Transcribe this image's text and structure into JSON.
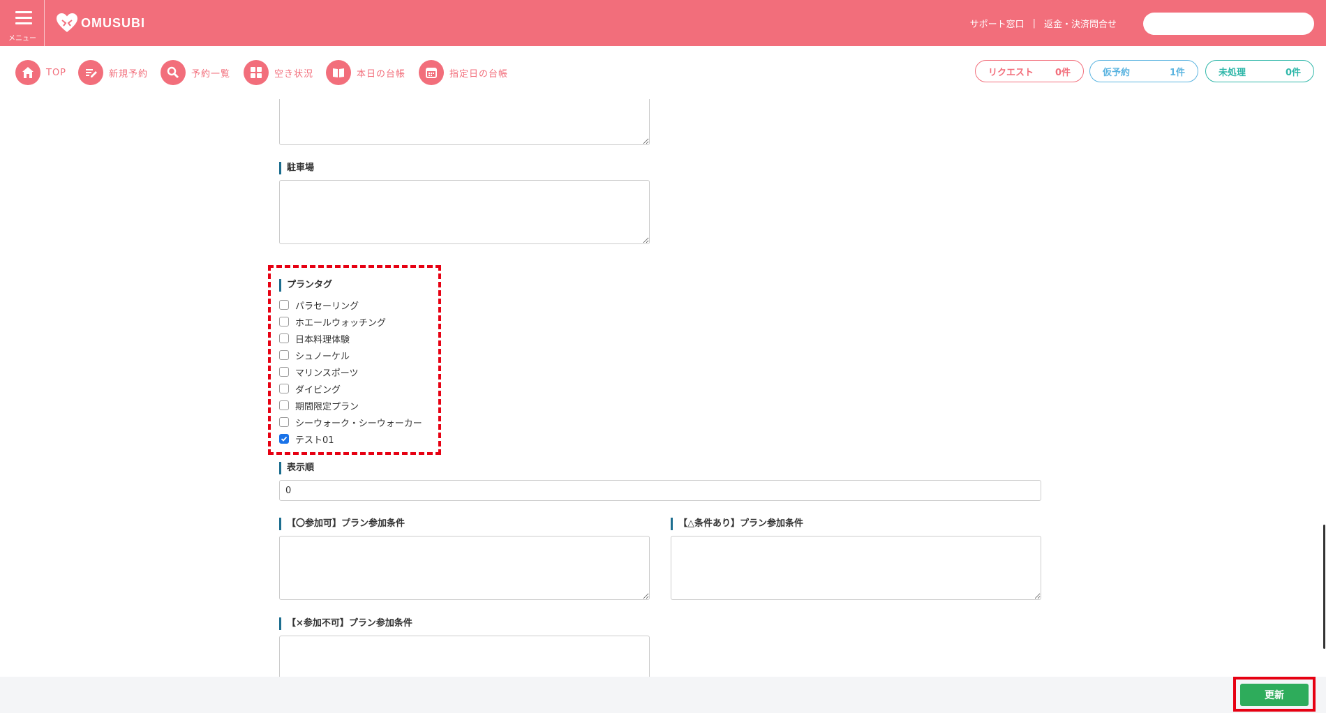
{
  "header": {
    "menu_label": "メニュー",
    "logo_text": "OMUSUBI",
    "links": {
      "support": "サポート窓口",
      "refund": "返金・決済問合せ"
    },
    "search_placeholder": ""
  },
  "nav": {
    "items": [
      {
        "label": "TOP",
        "icon": "home-icon"
      },
      {
        "label": "新規予約",
        "icon": "pencil-icon"
      },
      {
        "label": "予約一覧",
        "icon": "search-icon"
      },
      {
        "label": "空き状況",
        "icon": "grid-icon"
      },
      {
        "label": "本日の台帳",
        "icon": "book-icon"
      },
      {
        "label": "指定日の台帳",
        "icon": "calendar-icon"
      }
    ],
    "pills": {
      "request": {
        "label": "リクエスト",
        "count": "0件"
      },
      "provisional": {
        "label": "仮予約",
        "count": "1件"
      },
      "unprocessed": {
        "label": "未処理",
        "count": "0件"
      }
    }
  },
  "form": {
    "parking_label": "駐車場",
    "plan_tag_label": "プランタグ",
    "plan_tags": [
      {
        "label": "パラセーリング",
        "checked": false
      },
      {
        "label": "ホエールウォッチング",
        "checked": false
      },
      {
        "label": "日本料理体験",
        "checked": false
      },
      {
        "label": "シュノーケル",
        "checked": false
      },
      {
        "label": "マリンスポーツ",
        "checked": false
      },
      {
        "label": "ダイビング",
        "checked": false
      },
      {
        "label": "期間限定プラン",
        "checked": false
      },
      {
        "label": "シーウォーク・シーウォーカー",
        "checked": false
      },
      {
        "label": "テスト01",
        "checked": true
      }
    ],
    "display_order_label": "表示順",
    "display_order_value": "0",
    "cond_ok_label": "【〇参加可】プラン参加条件",
    "cond_conditional_label": "【△条件あり】プラン参加条件",
    "cond_ng_label": "【×参加不可】プラン参加条件"
  },
  "footer": {
    "update_label": "更新"
  },
  "colors": {
    "brand": "#f26e7b",
    "label_bar": "#1d6e8f",
    "update": "#2eac5b",
    "highlight": "#e60012"
  }
}
